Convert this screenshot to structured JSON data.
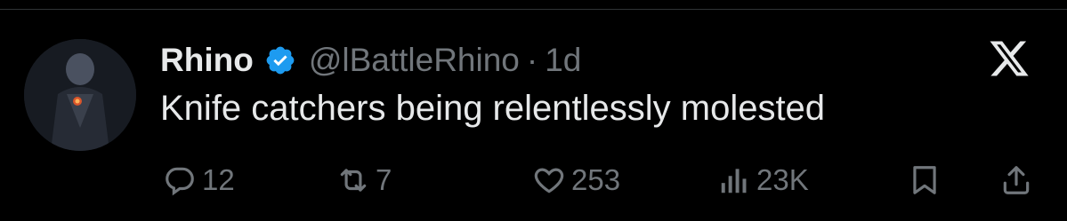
{
  "tweet": {
    "author_name": "Rhino",
    "handle": "@lBattleRhino",
    "separator": "·",
    "time": "1d",
    "text": "Knife catchers being relentlessly molested",
    "verified": true
  },
  "actions": {
    "replies": "12",
    "retweets": "7",
    "likes": "253",
    "views": "23K"
  },
  "colors": {
    "background": "#000000",
    "text": "#e7e9ea",
    "muted": "#71767b",
    "verified_badge": "#1d9bf0"
  },
  "icons": [
    "verified-badge-icon",
    "x-logo-icon",
    "reply-icon",
    "retweet-icon",
    "like-icon",
    "views-icon",
    "bookmark-icon",
    "share-icon"
  ]
}
